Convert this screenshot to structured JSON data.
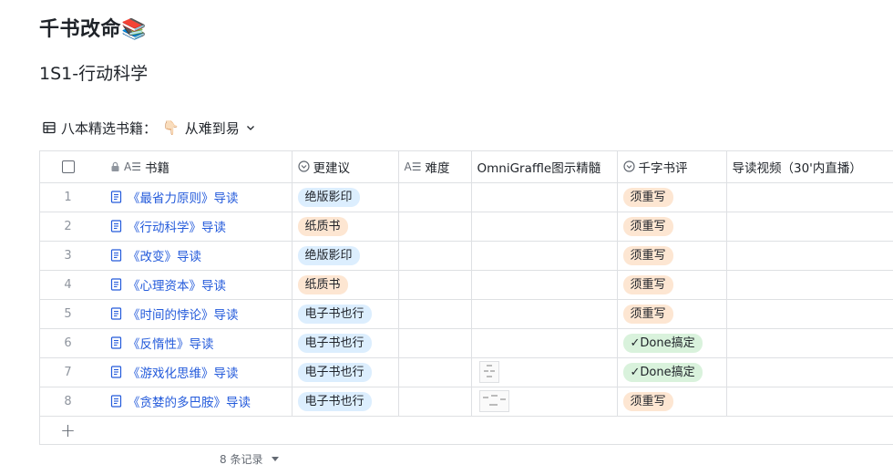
{
  "page": {
    "title": "千书改命📚",
    "section_title": "1S1-行动科学"
  },
  "view": {
    "label": "八本精选书籍：",
    "hand": "👇🏻",
    "sort_label": "从难到易"
  },
  "columns": {
    "book": "书籍",
    "suggestion": "更建议",
    "difficulty": "难度",
    "omni": "OmniGraffle图示精髓",
    "review": "千字书评",
    "video": "导读视频（30'内直播）"
  },
  "colors": {
    "tag_blue": "#dceefe",
    "tag_orange": "#fde6d2",
    "tag_green": "#d9f2dc",
    "tag_peach": "#fde6d2",
    "link": "#245bdb"
  },
  "rows": [
    {
      "num": "1",
      "book": "《最省力原则》导读",
      "suggestion": "绝版影印",
      "sugg_color": "#dceefe",
      "review": "须重写",
      "review_color": "#fde6d2",
      "thumb": false
    },
    {
      "num": "2",
      "book": "《行动科学》导读",
      "suggestion": "纸质书",
      "sugg_color": "#fde6d2",
      "review": "须重写",
      "review_color": "#fde6d2",
      "thumb": false
    },
    {
      "num": "3",
      "book": "《改变》导读",
      "suggestion": "绝版影印",
      "sugg_color": "#dceefe",
      "review": "须重写",
      "review_color": "#fde6d2",
      "thumb": false
    },
    {
      "num": "4",
      "book": "《心理资本》导读",
      "suggestion": "纸质书",
      "sugg_color": "#fde6d2",
      "review": "须重写",
      "review_color": "#fde6d2",
      "thumb": false
    },
    {
      "num": "5",
      "book": "《时间的悖论》导读",
      "suggestion": "电子书也行",
      "sugg_color": "#dceefe",
      "review": "须重写",
      "review_color": "#fde6d2",
      "thumb": false
    },
    {
      "num": "6",
      "book": "《反惰性》导读",
      "suggestion": "电子书也行",
      "sugg_color": "#dceefe",
      "review": "✓Done搞定",
      "review_color": "#d9f2dc",
      "thumb": false
    },
    {
      "num": "7",
      "book": "《游戏化思维》导读",
      "suggestion": "电子书也行",
      "sugg_color": "#dceefe",
      "review": "✓Done搞定",
      "review_color": "#d9f2dc",
      "thumb": "tall"
    },
    {
      "num": "8",
      "book": "《贪婪的多巴胺》导读",
      "suggestion": "电子书也行",
      "sugg_color": "#dceefe",
      "review": "须重写",
      "review_color": "#fde6d2",
      "thumb": "wide"
    }
  ],
  "footer": {
    "record_count": "8 条记录"
  }
}
